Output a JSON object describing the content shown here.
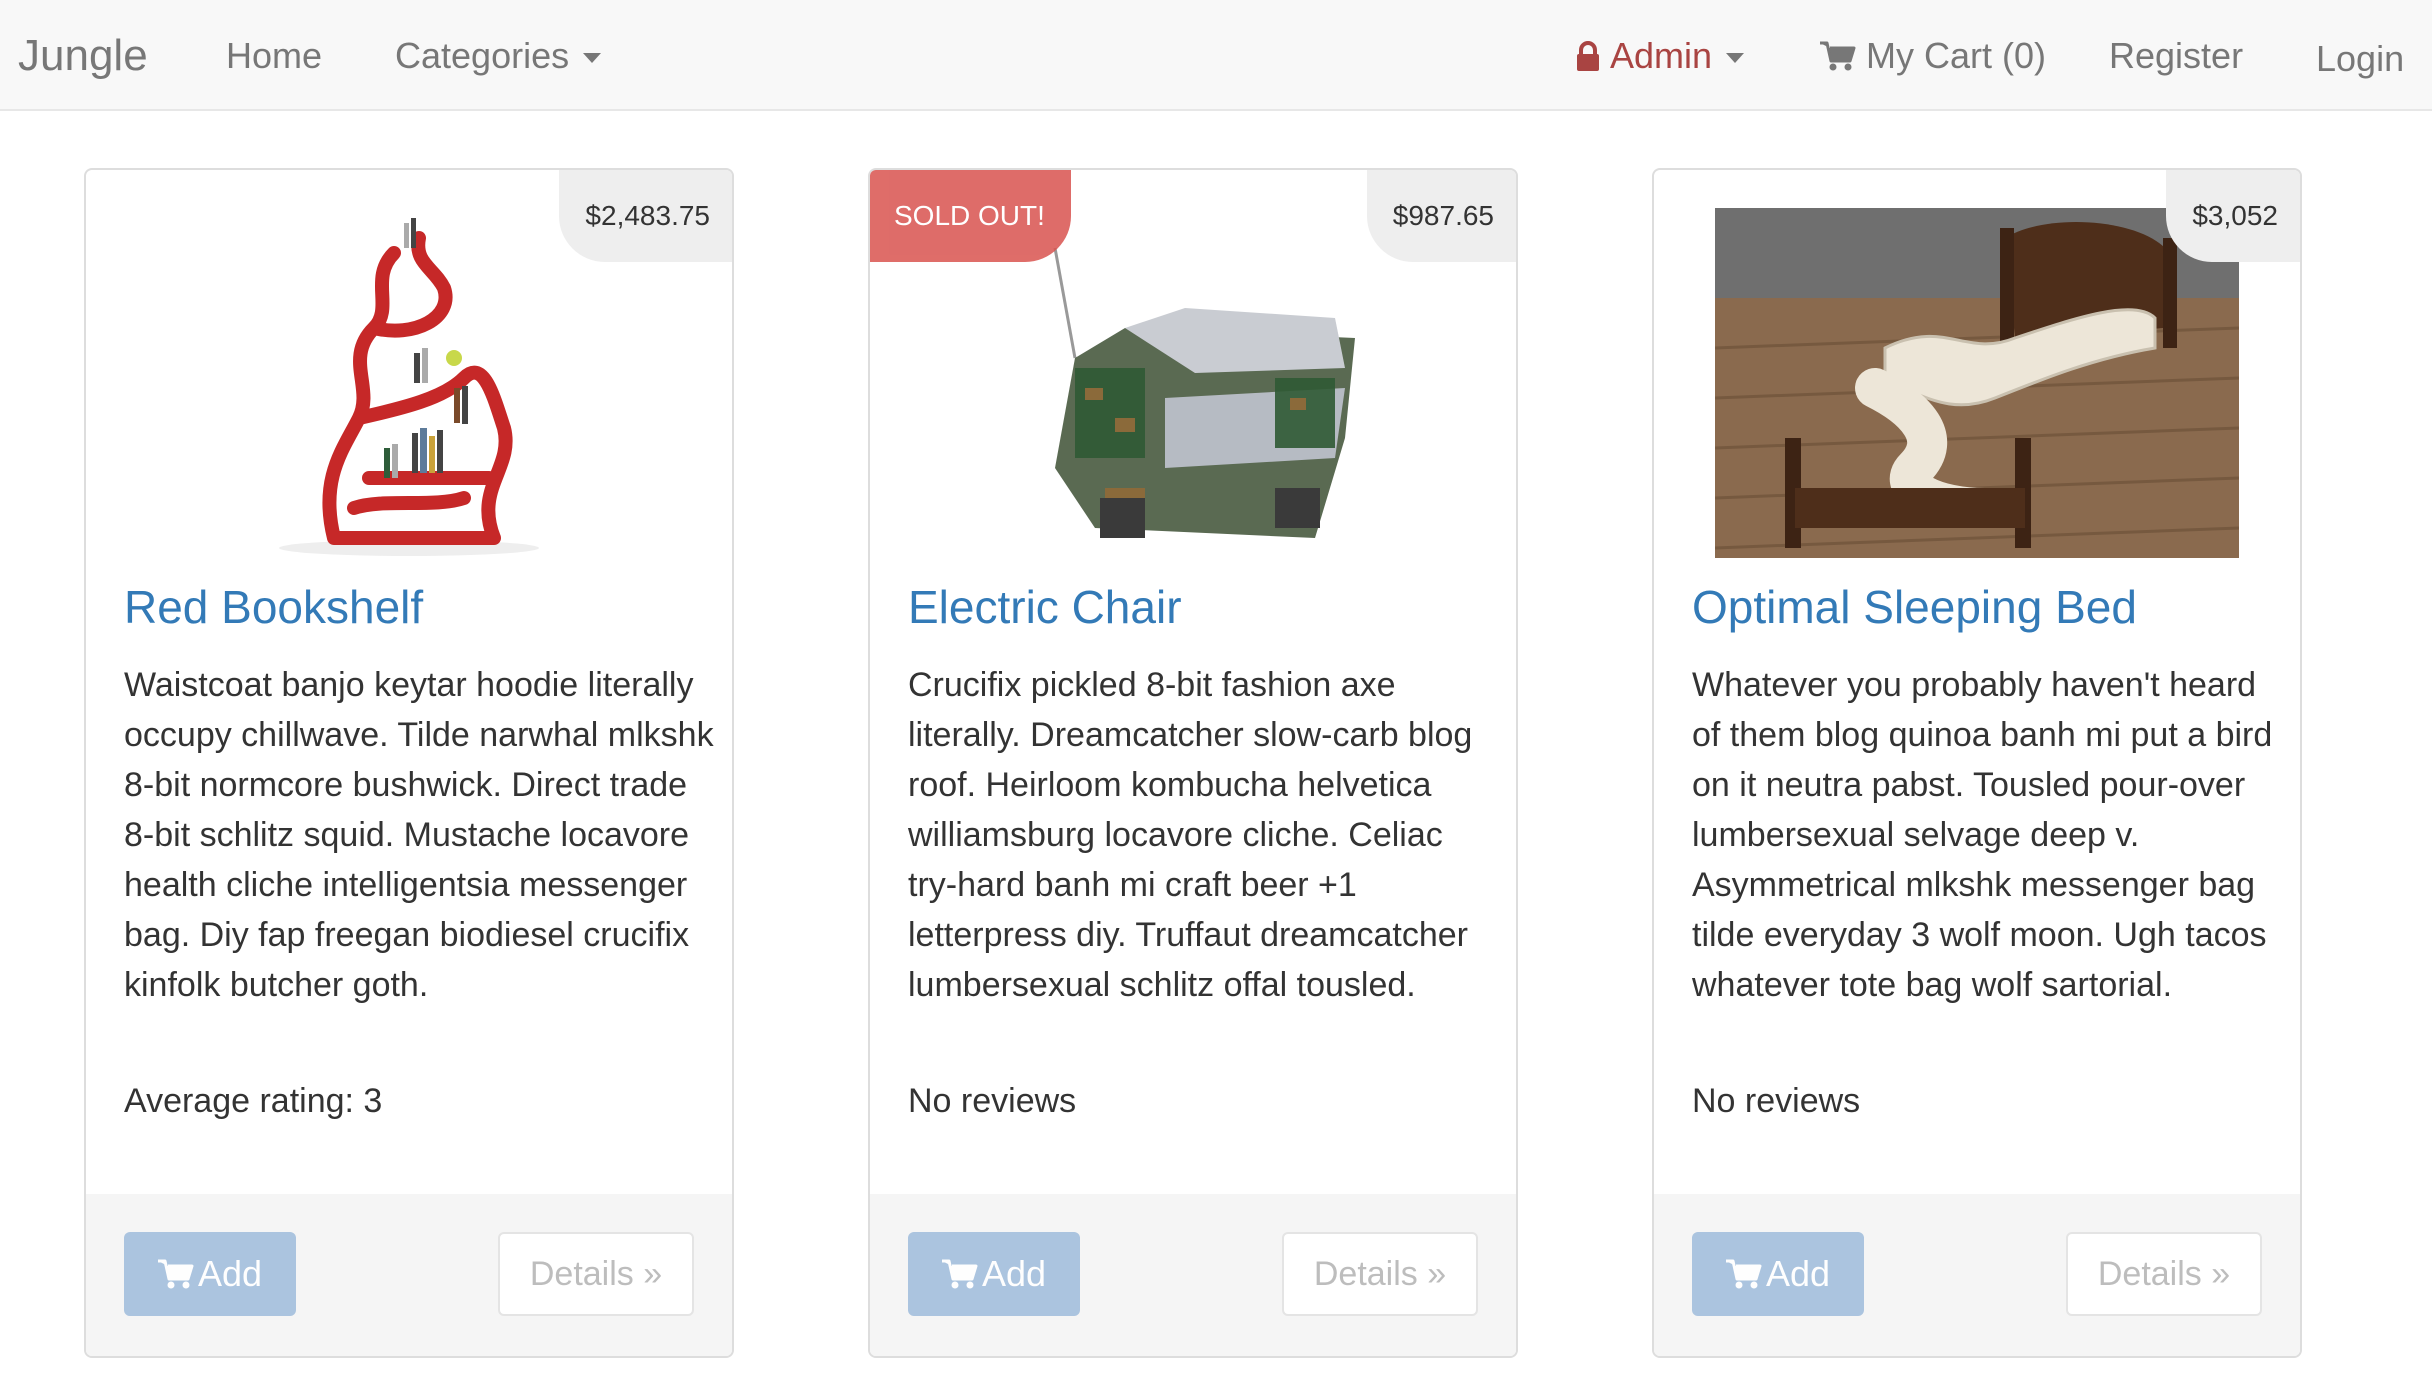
{
  "navbar": {
    "brand": "Jungle",
    "home": "Home",
    "categories": "Categories",
    "admin": "Admin",
    "cart": "My Cart (0)",
    "register": "Register",
    "login": "Login"
  },
  "products": [
    {
      "price": "$2,483.75",
      "title": "Red Bookshelf",
      "description": "Waistcoat banjo keytar hoodie literally occupy chillwave. Tilde narwhal mlkshk 8-bit normcore bushwick. Direct trade 8-bit schlitz squid. Mustache locavore health cliche intelligentsia messenger bag. Diy fap freegan biodiesel crucifix kinfolk butcher goth.",
      "rating": "Average rating: 3",
      "add_label": "Add",
      "details_label": "Details »"
    },
    {
      "badge": "SOLD OUT!",
      "price": "$987.65",
      "title": "Electric Chair",
      "description": "Crucifix pickled 8-bit fashion axe literally. Dreamcatcher slow-carb blog roof. Heirloom kombucha helvetica williamsburg locavore cliche. Celiac try-hard banh mi craft beer +1 letterpress diy. Truffaut dreamcatcher lumbersexual schlitz offal tousled.",
      "rating": "No reviews",
      "add_label": "Add",
      "details_label": "Details »"
    },
    {
      "price": "$3,052",
      "title": "Optimal Sleeping Bed",
      "description": "Whatever you probably haven't heard of them blog quinoa banh mi put a bird on it neutra pabst. Tousled pour-over lumbersexual selvage deep v. Asymmetrical mlkshk messenger bag tilde everyday 3 wolf moon. Ugh tacos whatever tote bag wolf sartorial.",
      "rating": "No reviews",
      "add_label": "Add",
      "details_label": "Details »"
    }
  ],
  "colors": {
    "link": "#337ab7",
    "sold": "#d9534f",
    "admin": "#a94442",
    "add_button": "#a3bfdd"
  }
}
